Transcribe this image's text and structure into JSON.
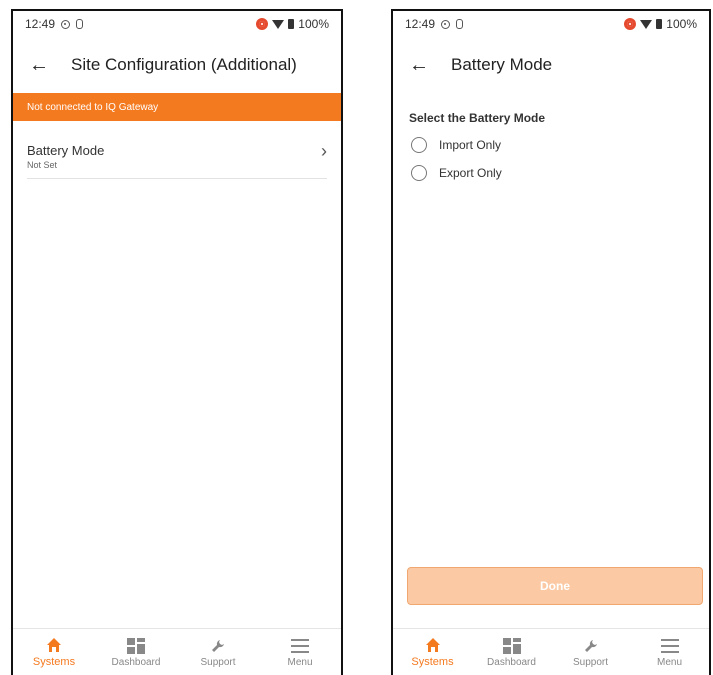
{
  "status_bar": {
    "time": "12:49",
    "battery": "100%"
  },
  "left_screen": {
    "title": "Site Configuration (Additional)",
    "banner": "Not connected to IQ Gateway",
    "rows": [
      {
        "label": "Battery Mode",
        "value": "Not Set"
      }
    ]
  },
  "right_screen": {
    "title": "Battery Mode",
    "section_title": "Select the Battery Mode",
    "options": [
      {
        "label": "Import Only"
      },
      {
        "label": "Export Only"
      }
    ],
    "done_label": "Done"
  },
  "nav": {
    "items": [
      {
        "label": "Systems",
        "icon": "home-icon",
        "active": true
      },
      {
        "label": "Dashboard",
        "icon": "dashboard-icon",
        "active": false
      },
      {
        "label": "Support",
        "icon": "wrench-icon",
        "active": false
      },
      {
        "label": "Menu",
        "icon": "hamburger-icon",
        "active": false
      }
    ]
  },
  "colors": {
    "accent": "#f47a20",
    "done_disabled": "#fbc9a4",
    "recording": "#e64a2e"
  }
}
